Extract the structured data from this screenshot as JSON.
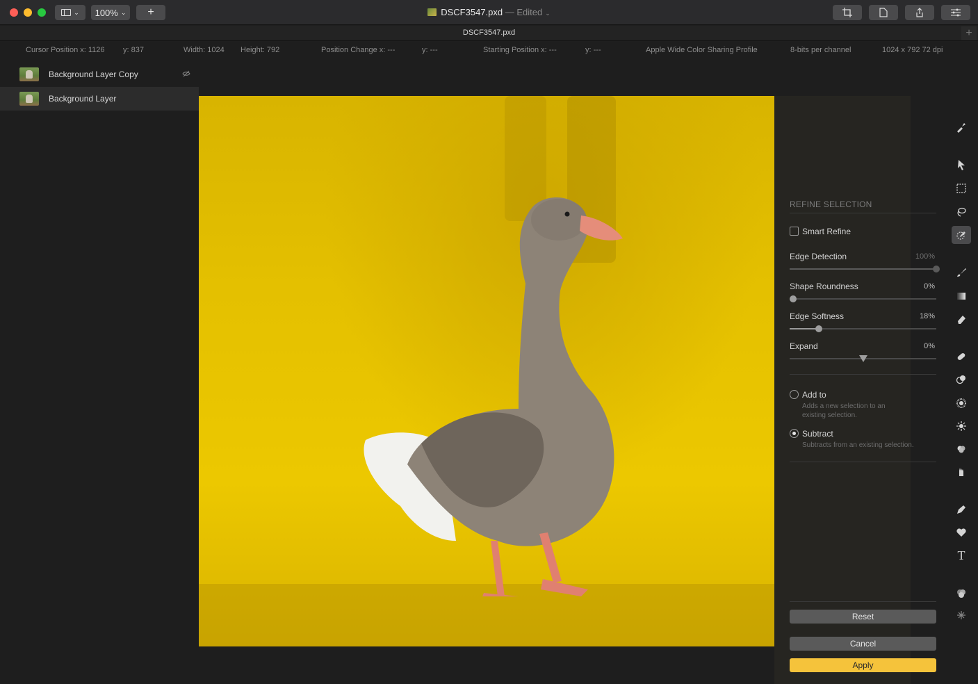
{
  "titlebar": {
    "zoom": "100%",
    "doc_name": "DSCF3547.pxd",
    "edited": " — Edited",
    "view_icon": "sidebar-icon",
    "add_icon": "plus-icon"
  },
  "tab": {
    "label": "DSCF3547.pxd"
  },
  "info": {
    "cursor_x": "Cursor Position x: 1126",
    "cursor_y": "y: 837",
    "width": "Width: 1024",
    "height": "Height: 792",
    "pos_change_x": "Position Change x: ---",
    "pos_change_y": "y: ---",
    "start_x": "Starting Position x: ---",
    "start_y": "y: ---",
    "profile": "Apple Wide Color Sharing Profile",
    "bits": "8-bits per channel",
    "dims": "1024  x 792 72 dpi"
  },
  "layers": [
    {
      "name": "Background Layer Copy",
      "hidden": true
    },
    {
      "name": "Background Layer",
      "selected": true
    }
  ],
  "refine": {
    "header": "REFINE SELECTION",
    "smart_refine": "Smart Refine",
    "edge_detection": {
      "label": "Edge Detection",
      "value": "100%",
      "level": 1.0
    },
    "shape_roundness": {
      "label": "Shape Roundness",
      "value": "0%",
      "level": 0.0
    },
    "edge_softness": {
      "label": "Edge Softness",
      "value": "18%",
      "level": 0.18
    },
    "expand": {
      "label": "Expand",
      "value": "0%",
      "level": 0.5
    },
    "add_to": {
      "label": "Add to",
      "desc": "Adds a new selection to an existing selection."
    },
    "subtract": {
      "label": "Subtract",
      "desc": "Subtracts from an existing selection."
    },
    "reset": "Reset",
    "cancel": "Cancel",
    "apply": "Apply"
  },
  "colors": {
    "accent": "#f5c33b",
    "overlay": "#e8c100"
  },
  "tools": [
    "quick-actions-icon",
    "arrange-icon",
    "rect-select-icon",
    "lasso-icon",
    "refine-brush-icon",
    "paint-brush-icon",
    "gradient-icon",
    "eraser-icon",
    "heal-icon",
    "clone-icon",
    "blur-icon",
    "dodge-icon",
    "sponge-icon",
    "smudge-icon",
    "pen-icon",
    "shape-icon",
    "type-icon",
    "color-adjust-icon",
    "effects-icon"
  ]
}
